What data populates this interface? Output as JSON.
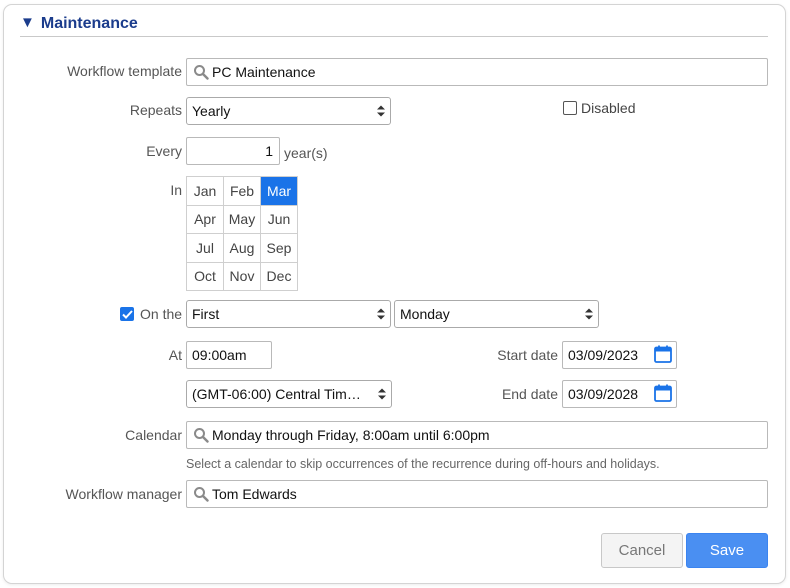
{
  "section": {
    "toggle_icon": "triangle-down-icon",
    "title": "Maintenance"
  },
  "form": {
    "workflow_template": {
      "label": "Workflow template",
      "value": "PC Maintenance",
      "icon": "search-icon"
    },
    "repeats": {
      "label": "Repeats",
      "value": "Yearly"
    },
    "disabled": {
      "label": "Disabled",
      "checked": false
    },
    "every": {
      "label": "Every",
      "value": "1",
      "unit": "year(s)"
    },
    "in": {
      "label": "In",
      "months": [
        [
          {
            "label": "Jan",
            "selected": false
          },
          {
            "label": "Feb",
            "selected": false
          },
          {
            "label": "Mar",
            "selected": true
          }
        ],
        [
          {
            "label": "Apr",
            "selected": false
          },
          {
            "label": "May",
            "selected": false
          },
          {
            "label": "Jun",
            "selected": false
          }
        ],
        [
          {
            "label": "Jul",
            "selected": false
          },
          {
            "label": "Aug",
            "selected": false
          },
          {
            "label": "Sep",
            "selected": false
          }
        ],
        [
          {
            "label": "Oct",
            "selected": false
          },
          {
            "label": "Nov",
            "selected": false
          },
          {
            "label": "Dec",
            "selected": false
          }
        ]
      ]
    },
    "on_the": {
      "label": "On the",
      "checked": true,
      "ordinal": "First",
      "weekday": "Monday"
    },
    "at": {
      "label": "At",
      "value": "09:00am"
    },
    "timezone": {
      "value": "(GMT-06:00) Central Tim…"
    },
    "start_date": {
      "label": "Start date",
      "value": "03/09/2023",
      "icon": "calendar-icon"
    },
    "end_date": {
      "label": "End date",
      "value": "03/09/2028",
      "icon": "calendar-icon"
    },
    "calendar": {
      "label": "Calendar",
      "value": "Monday through Friday, 8:00am until 6:00pm",
      "hint": "Select a calendar to skip occurrences of the recurrence during off-hours and holidays."
    },
    "workflow_manager": {
      "label": "Workflow manager",
      "value": "Tom Edwards"
    }
  },
  "actions": {
    "cancel": "Cancel",
    "save": "Save"
  },
  "colors": {
    "accent": "#1a73e8",
    "header_text": "#1b3c8c",
    "save_button": "#4a8ff2"
  }
}
